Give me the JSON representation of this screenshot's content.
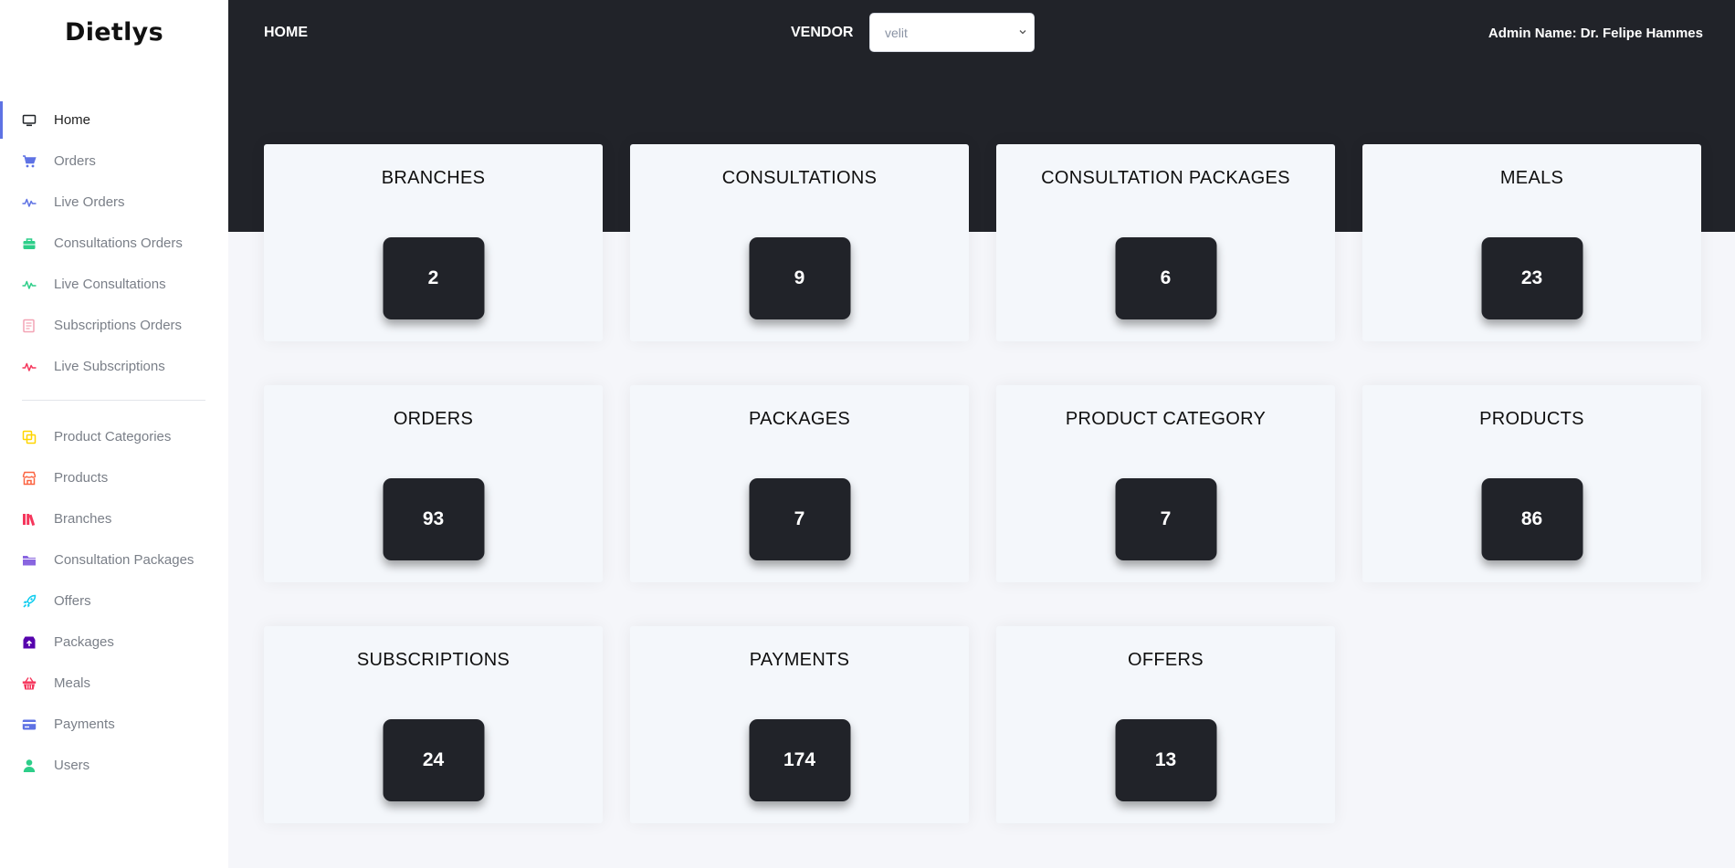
{
  "app": {
    "brand": "Dietlys"
  },
  "sidebar": {
    "primary": [
      {
        "label": "Home",
        "icon": "monitor-icon",
        "color": "#212529",
        "active": true
      },
      {
        "label": "Orders",
        "icon": "cart-icon",
        "color": "#5e72e4"
      },
      {
        "label": "Live Orders",
        "icon": "pulse-icon",
        "color": "#5e72e4"
      },
      {
        "label": "Consultations Orders",
        "icon": "briefcase-icon",
        "color": "#2dce89"
      },
      {
        "label": "Live Consultations",
        "icon": "pulse-icon",
        "color": "#2dce89"
      },
      {
        "label": "Subscriptions Orders",
        "icon": "document-icon",
        "color": "#f3a4b5"
      },
      {
        "label": "Live Subscriptions",
        "icon": "pulse-icon",
        "color": "#f5365c"
      }
    ],
    "secondary": [
      {
        "label": "Product Categories",
        "icon": "layers-icon",
        "color": "#ffd600"
      },
      {
        "label": "Products",
        "icon": "shop-icon",
        "color": "#fb6340"
      },
      {
        "label": "Branches",
        "icon": "books-icon",
        "color": "#f5365c"
      },
      {
        "label": "Consultation Packages",
        "icon": "folder-icon",
        "color": "#8965e0"
      },
      {
        "label": "Offers",
        "icon": "rocket-icon",
        "color": "#11cdef"
      },
      {
        "label": "Packages",
        "icon": "box-icon",
        "color": "#5603ad"
      },
      {
        "label": "Meals",
        "icon": "basket-icon",
        "color": "#f5365c"
      },
      {
        "label": "Payments",
        "icon": "credit-card-icon",
        "color": "#5e72e4"
      },
      {
        "label": "Users",
        "icon": "user-icon",
        "color": "#2dce89"
      }
    ]
  },
  "header": {
    "home_label": "HOME",
    "vendor_label": "VENDOR",
    "vendor_value": "velit",
    "admin_label": "Admin Name: Dr. Felipe Hammes"
  },
  "stats": [
    {
      "title": "BRANCHES",
      "value": "2"
    },
    {
      "title": "CONSULTATIONS",
      "value": "9"
    },
    {
      "title": "CONSULTATION PACKAGES",
      "value": "6"
    },
    {
      "title": "MEALS",
      "value": "23"
    },
    {
      "title": "ORDERS",
      "value": "93"
    },
    {
      "title": "PACKAGES",
      "value": "7"
    },
    {
      "title": "PRODUCT CATEGORY",
      "value": "7"
    },
    {
      "title": "PRODUCTS",
      "value": "86"
    },
    {
      "title": "SUBSCRIPTIONS",
      "value": "24"
    },
    {
      "title": "PAYMENTS",
      "value": "174"
    },
    {
      "title": "OFFERS",
      "value": "13"
    }
  ]
}
